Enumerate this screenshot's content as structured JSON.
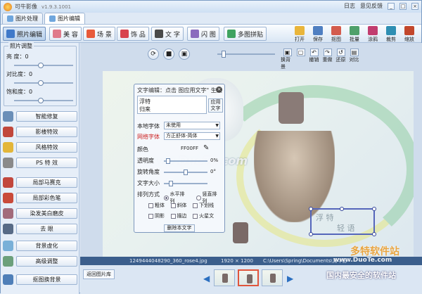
{
  "titlebar": {
    "app_name": "可牛影像",
    "version": "v1.9.3.1001",
    "right_links": [
      "日志",
      "意见反馈"
    ],
    "win_btns": [
      "_",
      "□",
      "×"
    ]
  },
  "tabs": [
    {
      "label": "图片处理"
    },
    {
      "label": "图片编辑"
    }
  ],
  "modes": [
    {
      "label": "照片编辑",
      "icon": "photo-edit-icon",
      "color": "#3f79c9"
    },
    {
      "label": "美 容",
      "icon": "beauty-icon",
      "color": "#e07a8a"
    },
    {
      "label": "场 景",
      "icon": "scene-icon",
      "color": "#e85a3a"
    },
    {
      "label": "饰 品",
      "icon": "accessory-icon",
      "color": "#d8434d"
    },
    {
      "label": "文 字",
      "icon": "text-icon",
      "color": "#4a4a4a"
    },
    {
      "label": "闪 图",
      "icon": "flash-icon",
      "color": "#8a6bbd"
    },
    {
      "label": "多图拼贴",
      "icon": "collage-icon",
      "color": "#3fa35f"
    }
  ],
  "right_tools": [
    {
      "label": "打开",
      "icon": "open-icon",
      "color": "#e9b53a"
    },
    {
      "label": "保存",
      "icon": "save-icon",
      "color": "#4f7fc1"
    },
    {
      "label": "抠图",
      "icon": "cutout-icon",
      "color": "#d35b4c"
    },
    {
      "label": "批量",
      "icon": "batch-icon",
      "color": "#4fa06a"
    },
    {
      "label": "涂鸦",
      "icon": "doodle-icon",
      "color": "#c13d6f"
    },
    {
      "label": "裁剪",
      "icon": "crop-icon",
      "color": "#2f8fb3"
    },
    {
      "label": "缩放",
      "icon": "resize-icon",
      "color": "#c2472b"
    }
  ],
  "left": {
    "group_title": "照片调整",
    "adjustments": [
      {
        "label": "亮 度：0",
        "level": 0.45
      },
      {
        "label": "对比度：0",
        "level": 0.45
      },
      {
        "label": "饱和度：0",
        "level": 0.45
      }
    ],
    "effects": [
      {
        "label": "智能修复",
        "icon": "smart-fix-icon",
        "color": "#6b8fb8"
      },
      {
        "label": "影楼特效",
        "icon": "studio-effect-icon",
        "color": "#c1473b"
      },
      {
        "label": "风格特效",
        "icon": "style-effect-icon",
        "color": "#e3b63a"
      },
      {
        "label": "PS 特 效",
        "icon": "ps-effect-icon",
        "color": "#8a8a8a"
      },
      {
        "label": "局部马赛克",
        "icon": "mosaic-icon",
        "color": "#c2473d"
      },
      {
        "label": "局部彩色笔",
        "icon": "color-pen-icon",
        "color": "#c94a3a"
      },
      {
        "label": "染发美白磨皮",
        "icon": "skin-icon",
        "color": "#a26b7b"
      },
      {
        "label": "去 眼",
        "icon": "eye-icon",
        "color": "#586b86"
      },
      {
        "label": "背景虚化",
        "icon": "blur-icon",
        "color": "#79b0d8"
      },
      {
        "label": "高级调整",
        "icon": "advanced-icon",
        "color": "#6ca07b"
      },
      {
        "label": "抠图换背景",
        "icon": "cutout-bg-icon",
        "color": "#4f7fb8"
      }
    ]
  },
  "canvas": {
    "view_btns": [
      "⟳",
      "■",
      "▣"
    ],
    "zoom_level": 0.08,
    "side_tools": [
      {
        "label": "换背景",
        "glyph": "▣"
      },
      {
        "label": "",
        "glyph": "▢"
      },
      {
        "label": "撤销",
        "glyph": "↶"
      },
      {
        "label": "重做",
        "glyph": "↷"
      },
      {
        "label": "还原",
        "glyph": "↺"
      },
      {
        "label": "对比",
        "glyph": "▤"
      }
    ],
    "sel_texts": [
      "浮 特",
      "轻 语"
    ]
  },
  "text_dialog": {
    "title": "文字编辑：点击 图应用文字\" 生效",
    "close": "×",
    "text_lines": [
      "浮特",
      "   归来"
    ],
    "apply_label": "应用文字",
    "font_label": "本地字体",
    "font_value": "未使用",
    "net_font_label": "网络字体",
    "net_font_value": "方正舒体-简体",
    "color_label": "颜色",
    "color_value": "FF00FF",
    "opacity_label": "透明度",
    "opacity_value": "0%",
    "opacity_level": 0.05,
    "rotate_label": "旋转角度",
    "rotate_value": "0°",
    "rotate_level": 0.5,
    "size_label": "文字大小",
    "size_value": "",
    "size_level": 0.12,
    "layout_label": "排列方式",
    "layout_options": [
      "水平排列",
      "竖直排列"
    ],
    "styles": [
      "粗体",
      "斜体",
      "下划线",
      "阴影",
      "描边",
      "火星文"
    ],
    "delete_label": "删除本文字"
  },
  "status": {
    "filename": "1249444048290_360_rose4.jpg",
    "dims": "1920 × 1200",
    "path": "C:\\Users\\Spring\\Documents\\青牛影"
  },
  "filmstrip": {
    "back_label": "返回图片库",
    "thumbs": 3,
    "selected": 1
  },
  "watermarks": [
    "www.DuoTe.com",
    "多特软件站",
    "国内最安全的软件站",
    "www.DuoTe.com"
  ]
}
